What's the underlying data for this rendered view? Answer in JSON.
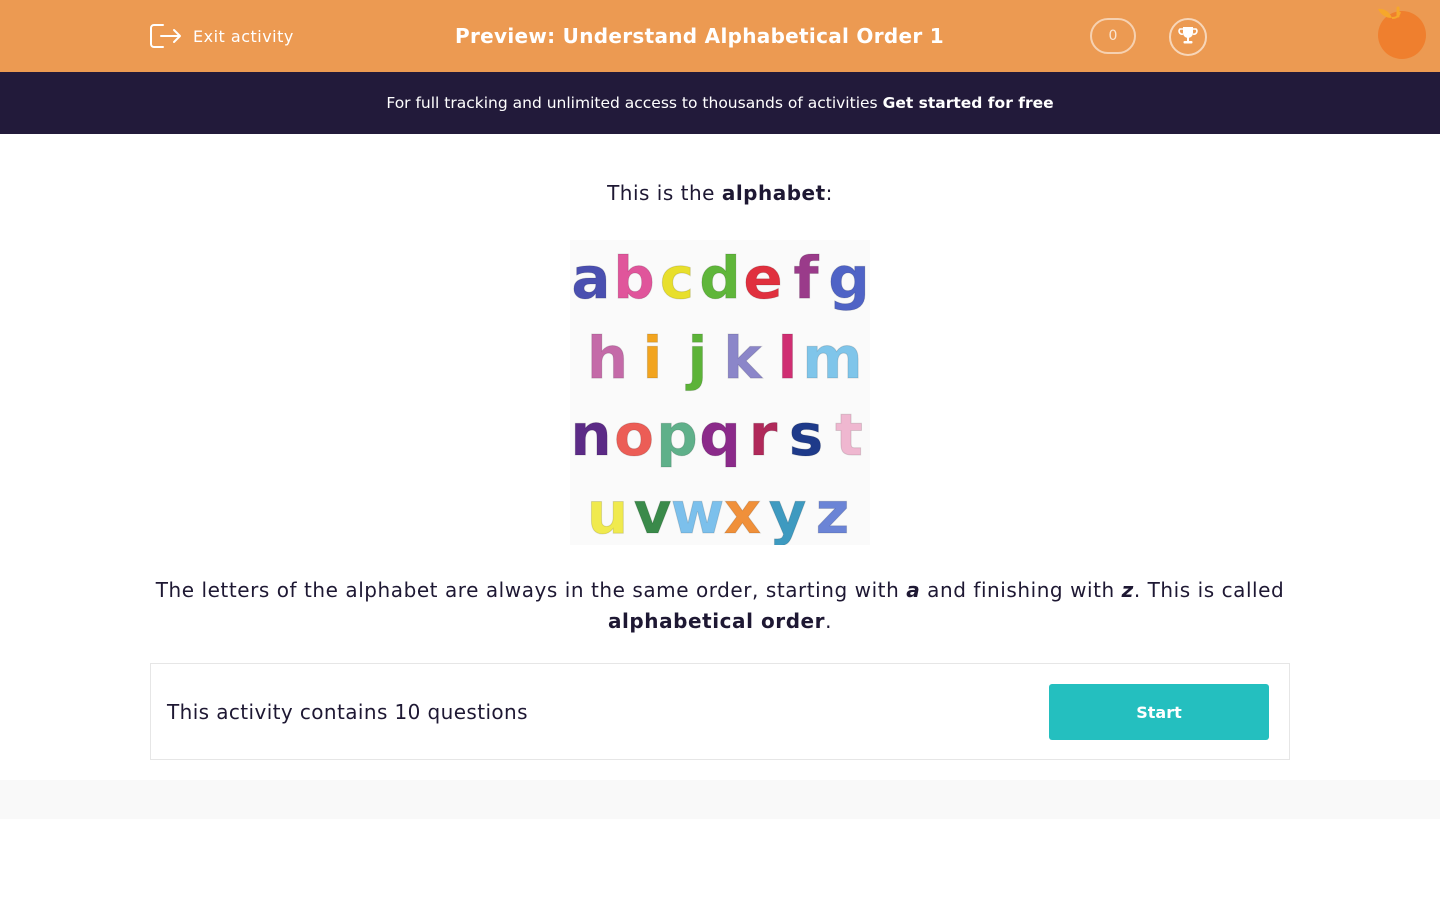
{
  "header": {
    "exit_label": "Exit activity",
    "title": "Preview: Understand Alphabetical Order 1",
    "score": "0",
    "trophy_icon": "trophy-icon",
    "logo_icon": "orange-logo",
    "bg_color": "#ec9a52"
  },
  "banner": {
    "text": "For full tracking and unlimited access to thousands of activities",
    "cta": "Get started for free",
    "bg_color": "#221a3a"
  },
  "intro": {
    "prefix": "This is the ",
    "bold": "alphabet",
    "suffix": ":"
  },
  "alphabet_rows": [
    [
      "a",
      "b",
      "c",
      "d",
      "e",
      "f",
      "g"
    ],
    [
      "h",
      "i",
      "j",
      "k",
      "l",
      "m"
    ],
    [
      "n",
      "o",
      "p",
      "q",
      "r",
      "s",
      "t"
    ],
    [
      "u",
      "v",
      "w",
      "x",
      "y",
      "z"
    ]
  ],
  "letter_colors": {
    "a": "#4a4fb0",
    "b": "#e0559b",
    "c": "#e8df2c",
    "d": "#5fb63a",
    "e": "#e0303e",
    "f": "#9a3b8a",
    "g": "#4f63c6",
    "h": "#c46aa8",
    "i": "#f2a41f",
    "j": "#5cb338",
    "k": "#8b86c9",
    "l": "#cf2e72",
    "m": "#7fc5ea",
    "n": "#5b2a86",
    "o": "#ec5d56",
    "p": "#5fb08a",
    "q": "#8b2a8a",
    "r": "#b0295a",
    "s": "#1e3a8a",
    "t": "#efb7d0",
    "u": "#f0ea4e",
    "v": "#3a8a4a",
    "w": "#7cc0ec",
    "x": "#f0903a",
    "y": "#3e9ac0",
    "z": "#6b84d6"
  },
  "explanation": {
    "part1": "The letters of the alphabet are always in the same order, starting with ",
    "letter_a": "a",
    "part2": " and finishing with ",
    "letter_z": "z",
    "part3": ". This is called ",
    "bold": "alphabetical order",
    "part4": "."
  },
  "card": {
    "text": "This activity contains 10 questions",
    "start_label": "Start",
    "button_color": "#24bfbf"
  }
}
